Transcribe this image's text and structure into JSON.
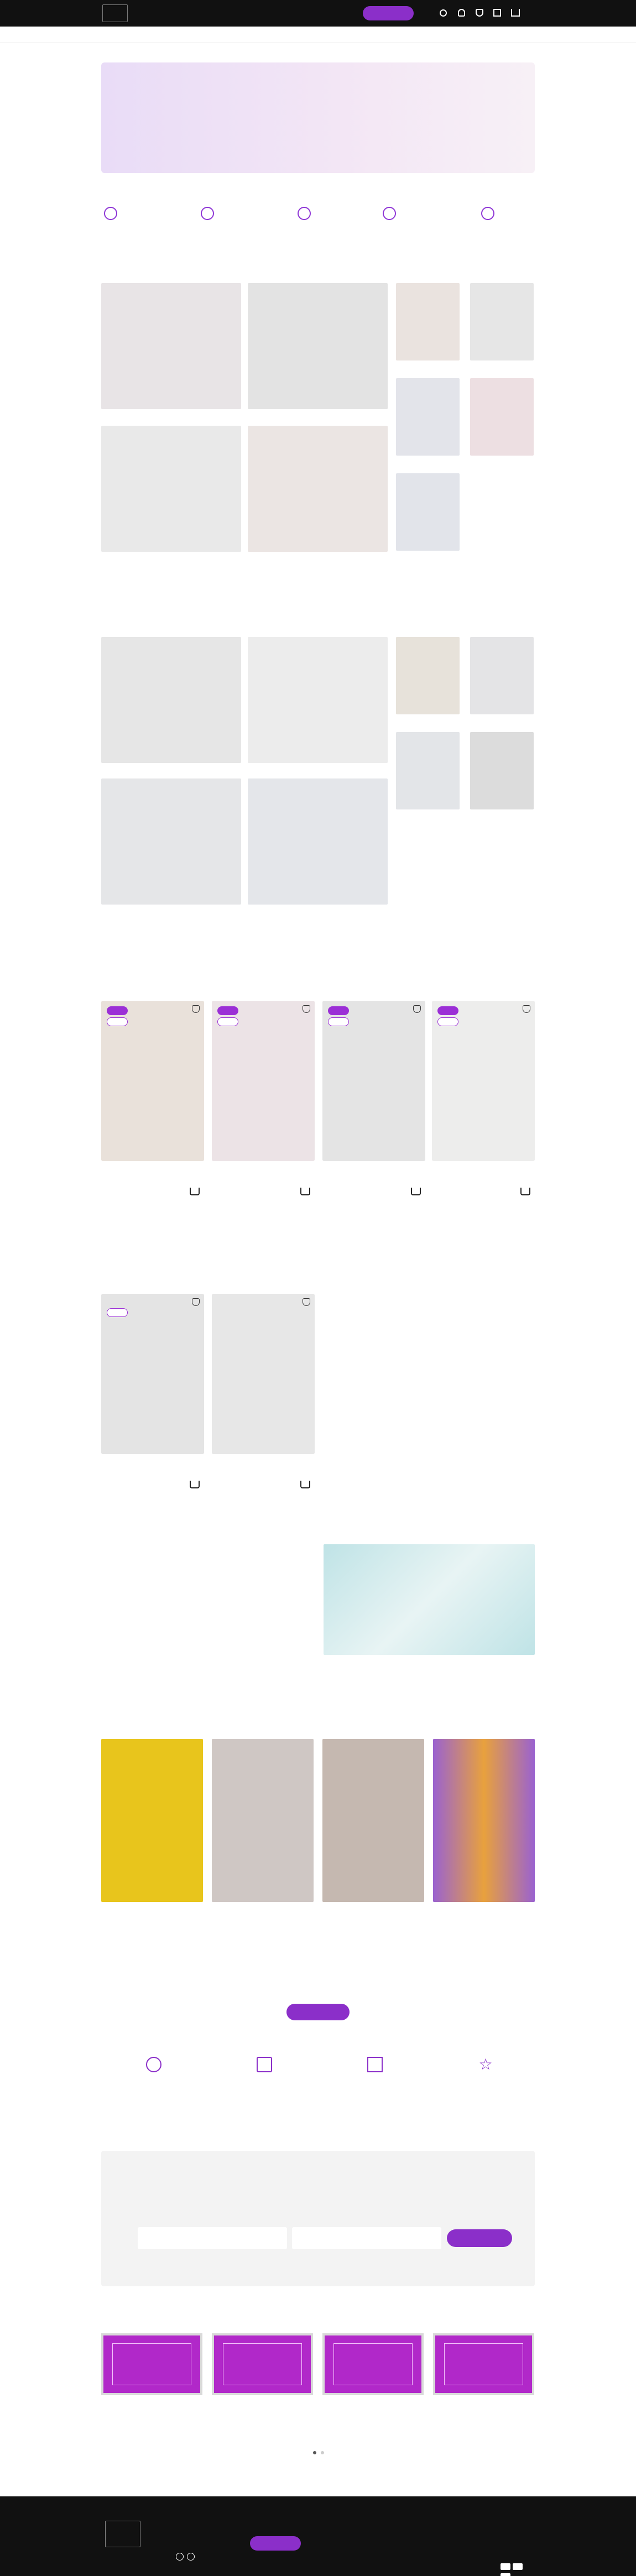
{
  "header": {
    "brand": "",
    "phone_1": "",
    "phone_2": "",
    "hours": "",
    "order_call": "",
    "nav_1": "",
    "nav_2": "",
    "nav_3": "",
    "nav_4": ""
  },
  "promo": {
    "line_1": "",
    "line_2": "",
    "side_text": ""
  },
  "features": [
    {
      "text": ""
    },
    {
      "text": ""
    },
    {
      "text": ""
    },
    {
      "text": ""
    },
    {
      "text": ""
    }
  ],
  "women": {
    "title_pre": "",
    "title_post": "",
    "tiles": [
      {
        "label": ""
      },
      {
        "label": ""
      },
      {
        "label": ""
      },
      {
        "label": ""
      },
      {
        "label": ""
      },
      {
        "label": ""
      },
      {
        "label": ""
      },
      {
        "label": ""
      },
      {
        "label": ""
      }
    ]
  },
  "men": {
    "title_pre": "",
    "title_post": "",
    "tiles": [
      {
        "label": ""
      },
      {
        "label": ""
      },
      {
        "label": ""
      },
      {
        "label": ""
      },
      {
        "label": ""
      },
      {
        "label": ""
      },
      {
        "label": ""
      },
      {
        "label": ""
      },
      {
        "label": ""
      }
    ]
  },
  "new_collection": {
    "title": "",
    "products": [
      {
        "badge": "",
        "discount": "",
        "price": "",
        "old_price": "",
        "name": ""
      },
      {
        "badge": "",
        "discount": "",
        "price": "",
        "old_price": "",
        "name": ""
      },
      {
        "badge": "",
        "discount": "",
        "price": "",
        "old_price": "",
        "name": ""
      },
      {
        "badge": "",
        "discount": "",
        "price": "",
        "old_price": "",
        "name": ""
      }
    ]
  },
  "popular": {
    "title": "",
    "products": [
      {
        "discount": "",
        "price": "",
        "old_price": "",
        "name": ""
      },
      {
        "price": "",
        "old_price": "",
        "name": ""
      }
    ]
  },
  "about": {
    "title": "",
    "body": "",
    "more": ""
  },
  "news": {
    "title": "",
    "items": [
      {
        "title": "",
        "text": "",
        "more": ""
      },
      {
        "title": "",
        "text": "",
        "more": ""
      },
      {
        "title": "",
        "text": "",
        "more": ""
      },
      {
        "title": "",
        "text": "",
        "more": ""
      }
    ],
    "all_button": ""
  },
  "benefits": [
    {
      "text": ""
    },
    {
      "text": ""
    },
    {
      "text": ""
    },
    {
      "text": ""
    }
  ],
  "subscribe": {
    "title": "",
    "subtitle": "",
    "name_placeholder": "",
    "email_placeholder": "",
    "button": ""
  },
  "articles": {
    "title": "",
    "items": [
      {
        "title": "",
        "text": "",
        "more": ""
      },
      {
        "title": "",
        "text": "",
        "more": ""
      },
      {
        "title": "",
        "text": "",
        "more": ""
      },
      {
        "title": "",
        "text": "",
        "more": ""
      }
    ]
  },
  "footer": {
    "links": [
      "",
      "",
      "",
      "",
      "",
      "",
      "",
      "",
      ""
    ],
    "brand": "",
    "phone_1": "",
    "phone_2": "",
    "email": "",
    "order_call": "",
    "hours": "",
    "address": "",
    "copyright": "",
    "legal": ""
  },
  "colors": {
    "accent": "#8b2fc9",
    "footer_bg": "#111111"
  }
}
